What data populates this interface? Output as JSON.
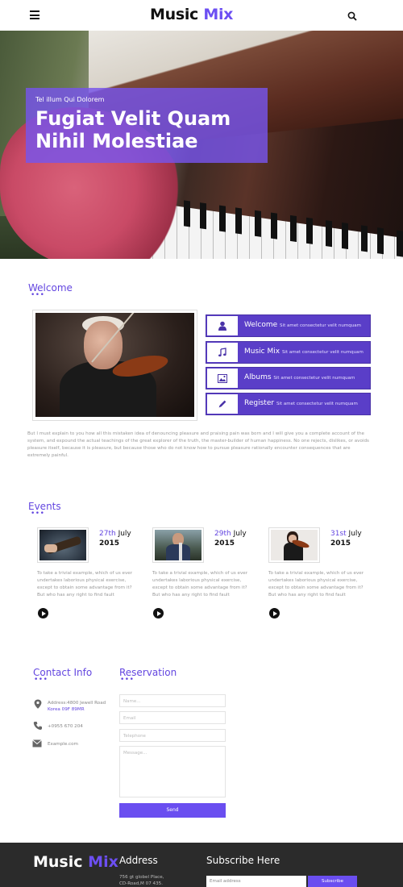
{
  "header": {
    "logo_part1": "Music",
    "logo_part2": "Mix"
  },
  "hero": {
    "subtitle": "Tel illum Qui Dolorem",
    "title": "Fugiat Velit Quam Nihil Molestiae"
  },
  "welcome": {
    "heading": "Welcome",
    "features": [
      {
        "title": "Welcome",
        "text": "Sit amet consectetur velit numquam",
        "icon": "user-icon"
      },
      {
        "title": "Music Mix",
        "text": "Sit amet consectetur velit numquam",
        "icon": "music-note-icon"
      },
      {
        "title": "Albums",
        "text": "Sit amet consectetur velit numquam",
        "icon": "image-icon"
      },
      {
        "title": "Register",
        "text": "Sit amet consectetur velit numquam",
        "icon": "pencil-icon"
      }
    ],
    "paragraph": "But I must explain to you how all this mistaken idea of denouncing pleasure and praising pain was born and I will give you a complete account of the system, and expound the actual teachings of the great explorer of the truth, the master-builder of human happiness. No one rejects, dislikes, or avoids pleasure itself, because it is pleasure, but because those who do not know how to pursue pleasure rationally encounter consequences that are extremely painful."
  },
  "events": {
    "heading": "Events",
    "items": [
      {
        "day": "27th",
        "month": "July",
        "year": "2015",
        "text": "To take a trivial example, which of us ever undertakes laborious physical exercise, except to obtain some advantage from it? But who has any right to find fault"
      },
      {
        "day": "29th",
        "month": "July",
        "year": "2015",
        "text": "To take a trivial example, which of us ever undertakes laborious physical exercise, except to obtain some advantage from it? But who has any right to find fault"
      },
      {
        "day": "31st",
        "month": "July",
        "year": "2015",
        "text": "To take a trivial example, which of us ever undertakes laborious physical exercise, except to obtain some advantage from it? But who has any right to find fault"
      }
    ]
  },
  "contact": {
    "heading": "Contact Info",
    "address_line1": "Address:4800 Jewell Road",
    "address_line2": "Korea 09F 89MR",
    "phone": "+0955 670 204",
    "email": "Example.com"
  },
  "reservation": {
    "heading": "Reservation",
    "name_placeholder": "Name...",
    "email_placeholder": "Email",
    "phone_placeholder": "Telephone",
    "message_placeholder": "Message...",
    "send_label": "Send"
  },
  "footer": {
    "logo_part1": "Music",
    "logo_part2": "Mix",
    "address_heading": "Address",
    "address_line1": "756 gt globel Place,",
    "address_line2": "CD-Road,M 07 435.",
    "subscribe_heading": "Subscribe Here",
    "subscribe_placeholder": "Email address",
    "subscribe_label": "Subscribe"
  },
  "colors": {
    "accent": "#6346e0",
    "feature_bg": "#5a3ec8",
    "footer_bg": "#2b2b2b"
  }
}
